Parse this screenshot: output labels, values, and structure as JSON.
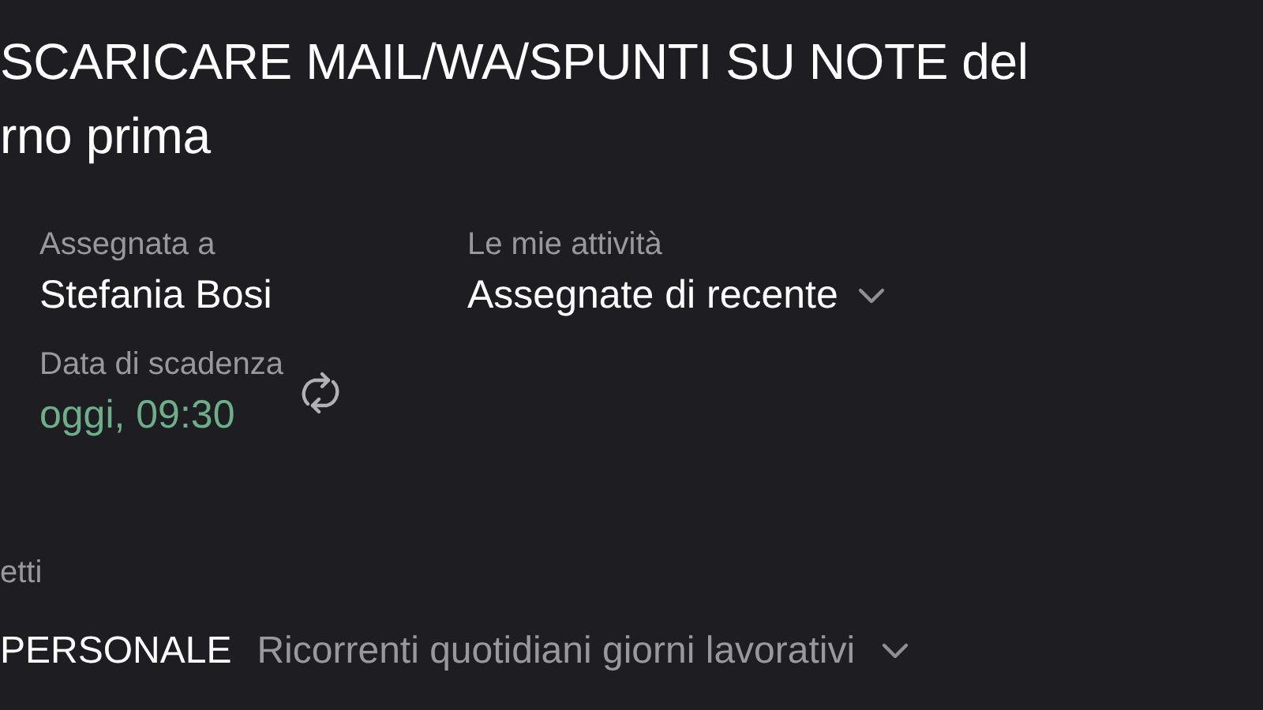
{
  "task": {
    "title": "SCARICARE MAIL/WA/SPUNTI SU NOTE del\nrno prima"
  },
  "fields": [
    {
      "label": "Assegnata a",
      "value": "Stefania Bosi",
      "kind": "plain"
    },
    {
      "label": "Le mie attività",
      "value": "Assegnate di recente",
      "kind": "dropdown"
    },
    {
      "label": "Data di scadenza",
      "value": "oggi, 09:30",
      "kind": "due"
    }
  ],
  "projects": {
    "label": "etti",
    "items": [
      {
        "project": "PERSONALE",
        "section": "Ricorrenti quotidiani giorni lavorativi"
      }
    ]
  }
}
